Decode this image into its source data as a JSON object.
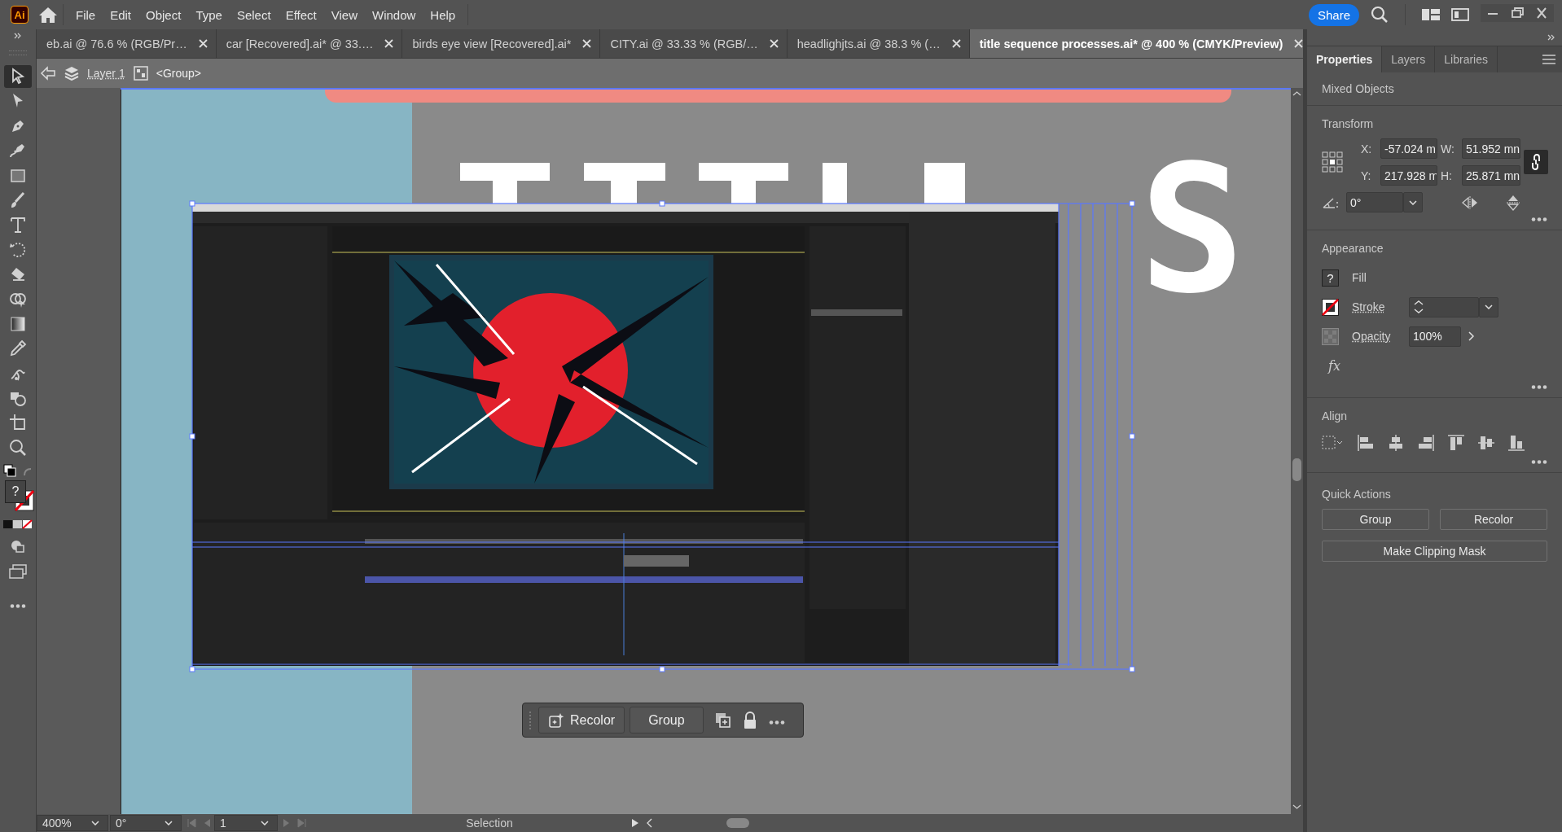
{
  "app": {
    "logo": "Ai"
  },
  "menu": [
    "File",
    "Edit",
    "Object",
    "Type",
    "Select",
    "Effect",
    "View",
    "Window",
    "Help"
  ],
  "share": "Share",
  "doc_tabs": [
    {
      "label": "eb.ai @ 76.6 % (RGB/Pr…",
      "selected": false
    },
    {
      "label": "car [Recovered].ai* @ 33.…",
      "selected": false
    },
    {
      "label": "birds eye view [Recovered].ai*",
      "selected": false
    },
    {
      "label": "CITY.ai @ 33.33 % (RGB/…",
      "selected": false
    },
    {
      "label": "headlighjts.ai @ 38.3 % (…",
      "selected": false
    },
    {
      "label": "title sequence processes.ai* @ 400 % (CMYK/Preview)",
      "selected": true
    }
  ],
  "breadcrumb": {
    "layer": "Layer 1",
    "group": "<Group>"
  },
  "tools": [
    {
      "kind": "selection",
      "selected": true
    },
    {
      "kind": "direct-selection",
      "selected": false
    },
    {
      "kind": "pen",
      "selected": false
    },
    {
      "kind": "curvature",
      "selected": false
    },
    {
      "kind": "rectangle",
      "selected": false
    },
    {
      "kind": "paintbrush",
      "selected": false
    },
    {
      "kind": "type",
      "selected": false
    },
    {
      "kind": "rotate",
      "selected": false
    },
    {
      "kind": "eraser",
      "selected": false
    },
    {
      "kind": "shape-builder",
      "selected": false
    },
    {
      "kind": "gradient",
      "selected": false
    },
    {
      "kind": "eyedropper",
      "selected": false
    },
    {
      "kind": "puppet-warp",
      "selected": false
    },
    {
      "kind": "blend",
      "selected": false
    },
    {
      "kind": "artboard",
      "selected": false
    },
    {
      "kind": "zoom",
      "selected": false
    }
  ],
  "fill_swatch": "?",
  "canvas": {
    "heading": "S"
  },
  "context_bar": {
    "recolor": "Recolor",
    "group": "Group"
  },
  "status_bar": {
    "zoom": "400%",
    "rotation": "0°",
    "artboard": "1",
    "tool": "Selection"
  },
  "panel": {
    "tabs": [
      {
        "label": "Properties",
        "selected": true
      },
      {
        "label": "Layers",
        "selected": false
      },
      {
        "label": "Libraries",
        "selected": false
      }
    ],
    "selection_type": "Mixed Objects",
    "transform": {
      "title": "Transform",
      "fields": [
        {
          "label": "X:",
          "value": "-57.024 m"
        },
        {
          "label": "W:",
          "value": "51.952 mn"
        },
        {
          "label": "Y:",
          "value": "217.928 m"
        },
        {
          "label": "H:",
          "value": "25.871 mn"
        }
      ],
      "angle": "0°"
    },
    "appearance": {
      "title": "Appearance",
      "fill_swatch": "?",
      "fill": "Fill",
      "stroke": "Stroke",
      "opacity_label": "Opacity",
      "opacity": "100%",
      "fx": "fx"
    },
    "align": {
      "title": "Align"
    },
    "quick_actions": {
      "title": "Quick Actions",
      "buttons": [
        "Group",
        "Recolor",
        "Make Clipping Mask"
      ]
    }
  }
}
